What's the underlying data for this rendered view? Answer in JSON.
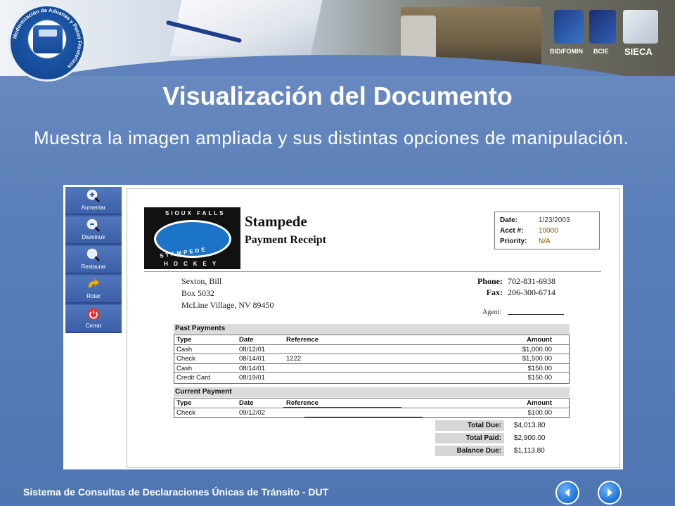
{
  "header": {
    "logo_ring_text": "Modernización de Aduanas y Pasos Fronterizos",
    "partners": [
      "BID/FOMIN",
      "BCIE",
      "SIECA"
    ]
  },
  "slide": {
    "title": "Visualización del Documento",
    "subtitle": "Muestra la imagen ampliada y sus distintas opciones de manipulación."
  },
  "viewer": {
    "tools": [
      {
        "label": "Aumentar",
        "icon": "zoom-in-icon"
      },
      {
        "label": "Disminuir",
        "icon": "zoom-out-icon"
      },
      {
        "label": "Restaurar",
        "icon": "restore-icon"
      },
      {
        "label": "Rotar",
        "icon": "rotate-icon"
      },
      {
        "label": "Cerrar",
        "icon": "power-icon"
      }
    ],
    "document": {
      "logo_top": "SIOUX FALLS",
      "logo_mid": "STAMPEDE",
      "logo_bottom": "HOCKEY",
      "name": "Stampede",
      "doc_type": "Payment Receipt",
      "info": {
        "date_label": "Date:",
        "date": "1/23/2003",
        "acct_label": "Acct #:",
        "acct": "10000",
        "priority_label": "Priority:",
        "priority": "N/A"
      },
      "address": [
        "Sexton, Bill",
        "Box 5032",
        "McLine Village, NV 89450"
      ],
      "phone_label": "Phone:",
      "phone": "702-831-6938",
      "fax_label": "Fax:",
      "fax": "206-300-6714",
      "agent_label": "Agent:",
      "past_payments": {
        "title": "Past Payments",
        "headers": [
          "Type",
          "Date",
          "Reference",
          "Amount"
        ],
        "rows": [
          [
            "Cash",
            "08/12/01",
            "",
            "$1,000.00"
          ],
          [
            "Check",
            "08/14/01",
            "1222",
            "$1,500.00"
          ],
          [
            "Cash",
            "08/14/01",
            "",
            "$150.00"
          ],
          [
            "Credit Card",
            "08/19/01",
            "",
            "$150.00"
          ]
        ]
      },
      "current_payment": {
        "title": "Current Payment",
        "headers": [
          "Type",
          "Date",
          "Reference",
          "Amount"
        ],
        "rows": [
          [
            "Check",
            "09/12/02",
            "",
            "$100.00"
          ]
        ]
      },
      "totals": [
        {
          "label": "Total Due:",
          "value": "$4,013.80"
        },
        {
          "label": "Total Paid:",
          "value": "$2,900.00"
        },
        {
          "label": "Balance Due:",
          "value": "$1,113.80"
        }
      ]
    }
  },
  "footer": {
    "text": "Sistema de Consultas de Declaraciones Únicas de Tránsito - DUT",
    "prev_icon": "arrow-left-icon",
    "next_icon": "arrow-right-icon"
  }
}
